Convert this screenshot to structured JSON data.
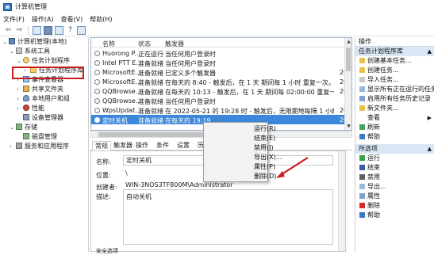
{
  "window": {
    "title": "计算机管理"
  },
  "menu": [
    "文件(F)",
    "操作(A)",
    "查看(V)",
    "帮助(H)"
  ],
  "tree": [
    {
      "label": "计算机管理(本地)",
      "exp": "⌄",
      "indent": 0,
      "icon": "pc",
      "name": "computer-management-icon"
    },
    {
      "label": "系统工具",
      "exp": "⌄",
      "indent": 1,
      "icon": "tool",
      "name": "system-tools-icon"
    },
    {
      "label": "任务计划程序",
      "exp": "⌄",
      "indent": 2,
      "icon": "clock",
      "name": "task-scheduler-icon"
    },
    {
      "label": "任务计划程序库",
      "exp": "›",
      "indent": 3,
      "icon": "fold",
      "name": "folder-icon"
    },
    {
      "label": "事件查看器",
      "exp": "›",
      "indent": 2,
      "icon": "ev",
      "name": "event-viewer-icon"
    },
    {
      "label": "共享文件夹",
      "exp": "›",
      "indent": 2,
      "icon": "share",
      "name": "shared-folder-icon"
    },
    {
      "label": "本地用户和组",
      "exp": "›",
      "indent": 2,
      "icon": "user",
      "name": "users-icon"
    },
    {
      "label": "性能",
      "exp": "›",
      "indent": 2,
      "icon": "perf",
      "name": "performance-icon"
    },
    {
      "label": "设备管理器",
      "exp": "",
      "indent": 2,
      "icon": "dev",
      "name": "device-manager-icon"
    },
    {
      "label": "存储",
      "exp": "⌄",
      "indent": 1,
      "icon": "disk",
      "name": "storage-icon"
    },
    {
      "label": "磁盘管理",
      "exp": "",
      "indent": 2,
      "icon": "disk",
      "name": "disk-management-icon"
    },
    {
      "label": "服务和应用程序",
      "exp": "›",
      "indent": 1,
      "icon": "svc",
      "name": "services-icon"
    }
  ],
  "grid": {
    "headers": [
      "名称",
      "状态",
      "触发器"
    ],
    "rows": [
      {
        "name": "Huorong P...",
        "status": "正在运行",
        "trigger": "当任何用户登录时",
        "extra": ""
      },
      {
        "name": "Intel PTT E...",
        "status": "准备就绪",
        "trigger": "当任何用户登录时",
        "extra": ""
      },
      {
        "name": "MicrosoftE...",
        "status": "准备就绪",
        "trigger": "已定义多个触发器",
        "extra": "20"
      },
      {
        "name": "MicrosoftE...",
        "status": "准备就绪",
        "trigger": "在每天的 8:40 - 触发后，在 1 天 期间每 1 小时 重复一次。",
        "extra": "20"
      },
      {
        "name": "QQBrowse...",
        "status": "准备就绪",
        "trigger": "在每天的 10:13 - 触发后，在 1 天 期间每 02:00:00 重复一次。",
        "extra": "20"
      },
      {
        "name": "QQBrowse...",
        "status": "准备就绪",
        "trigger": "当任何用户登录时",
        "extra": ""
      },
      {
        "name": "WpsUpdat...",
        "status": "准备就绪",
        "trigger": "在 2022-05-21 的 19:28 时 - 触发后，无限期地每隔 1 小时 重复一次。",
        "extra": "20"
      },
      {
        "name": "定时关机",
        "status": "准备就绪",
        "trigger": "在每天的 19:19",
        "extra": "20"
      }
    ]
  },
  "tabs": [
    "常规",
    "触发器",
    "操作",
    "条件",
    "设置",
    "历史记录"
  ],
  "props": {
    "name_label": "名称:",
    "name_value": "定时关机",
    "location_label": "位置:",
    "location_value": "\\",
    "author_label": "创建者:",
    "author_value": "WIN-3NOS3TF800M\\Administrator",
    "desc_label": "描述:",
    "desc_value": "自动关机",
    "security_label": "安全选项"
  },
  "context_menu": [
    "运行(R)",
    "结束(E)",
    "禁用(I)",
    "导出(X)...",
    "属性(P)",
    "删除(D)"
  ],
  "actions": {
    "header": "操作",
    "section1": "任务计划程序库",
    "items1": [
      "创建基本任务...",
      "创建任务...",
      "导入任务...",
      "显示所有正在运行的任务",
      "启用所有任务历史记录",
      "新文件夹...",
      "查看",
      "刷新",
      "帮助"
    ],
    "section2": "所选项",
    "items2": [
      "运行",
      "结束",
      "禁用",
      "导出...",
      "属性",
      "删除",
      "帮助"
    ]
  },
  "colors": {
    "selection": "#3d86d9",
    "highlight_box": "#cc1a1a",
    "arrow": "#c62020"
  }
}
